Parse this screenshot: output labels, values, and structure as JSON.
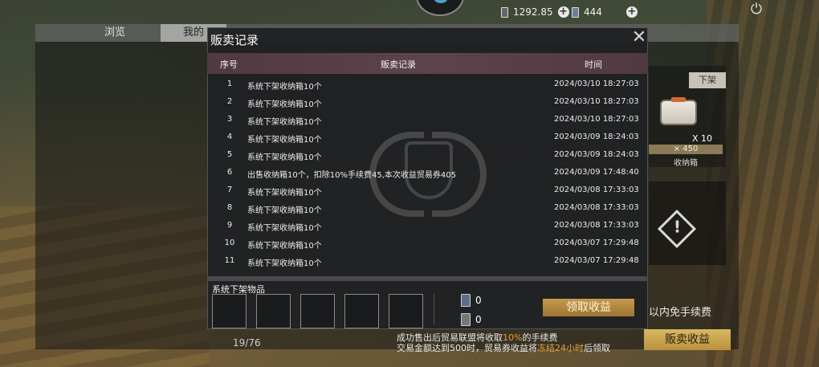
{
  "hud": {
    "currency1": "1292.85",
    "currency2": "444"
  },
  "back": {
    "tab_browse": "浏览",
    "tab_mine": "我的",
    "off_shelf": "下架",
    "item_count": "X 10",
    "item_price": "× 450",
    "item_name": "收纳箱",
    "tip_fragment": "以内免手续费",
    "page": "19/76",
    "sell_income_btn": "贩卖收益"
  },
  "modal": {
    "title": "贩卖记录",
    "headers": {
      "no": "序号",
      "record": "贩卖记录",
      "time": "时间"
    },
    "rows": [
      {
        "no": "1",
        "record": "系统下架收纳箱10个",
        "time": "2024/03/10 18:27:03"
      },
      {
        "no": "2",
        "record": "系统下架收纳箱10个",
        "time": "2024/03/10 18:27:03"
      },
      {
        "no": "3",
        "record": "系统下架收纳箱10个",
        "time": "2024/03/10 18:27:03"
      },
      {
        "no": "4",
        "record": "系统下架收纳箱10个",
        "time": "2024/03/09 18:24:03"
      },
      {
        "no": "5",
        "record": "系统下架收纳箱10个",
        "time": "2024/03/09 18:24:03"
      },
      {
        "no": "6",
        "record": "出售收纳箱10个，扣除10%手续费45,本次收益贸易券405",
        "time": "2024/03/09 17:48:40"
      },
      {
        "no": "7",
        "record": "系统下架收纳箱10个",
        "time": "2024/03/08 17:33:03"
      },
      {
        "no": "8",
        "record": "系统下架收纳箱10个",
        "time": "2024/03/08 17:33:03"
      },
      {
        "no": "9",
        "record": "系统下架收纳箱10个",
        "time": "2024/03/08 17:33:03"
      },
      {
        "no": "10",
        "record": "系统下架收纳箱10个",
        "time": "2024/03/07 17:29:48"
      },
      {
        "no": "11",
        "record": "系统下架收纳箱10个",
        "time": "2024/03/07 17:29:48"
      }
    ],
    "system_items_label": "系统下架物品",
    "ticket_a": "0",
    "ticket_b": "0",
    "claim_btn": "领取收益",
    "note1_pre": "成功售出后贸易联盟将收取",
    "note1_hl": "10%",
    "note1_post": "的手续费",
    "note2_pre": "交易金额达到500时，贸易券收益将",
    "note2_hl": "冻结24小时",
    "note2_post": "后领取"
  }
}
